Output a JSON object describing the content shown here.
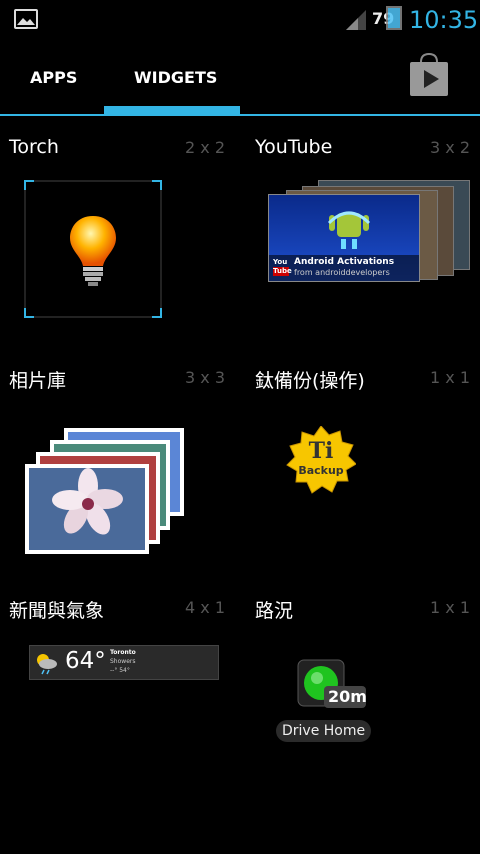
{
  "status_bar": {
    "battery_level": "79",
    "time": "10:35",
    "icons": [
      "image-icon",
      "signal-icon",
      "battery-icon"
    ]
  },
  "tabs": [
    {
      "label": "APPS",
      "selected": false
    },
    {
      "label": "WIDGETS",
      "selected": true
    }
  ],
  "store_icon": "play-store-icon",
  "accent_color": "#33b5e5",
  "widgets": [
    {
      "title": "Torch",
      "size": "2 x 2",
      "icon": "lightbulb-icon"
    },
    {
      "title": "YouTube",
      "size": "3 x 2",
      "icon": "youtube-widget-preview",
      "preview_title": "Android Activations",
      "preview_subtitle": "from androiddevelopers",
      "preview_logo_top": "You",
      "preview_logo_bottom": "Tube"
    },
    {
      "title": "相片庫",
      "size": "3 x 3",
      "icon": "photo-stack-icon"
    },
    {
      "title": "鈦備份(操作)",
      "size": "1 x 1",
      "icon": "titanium-backup-icon",
      "badge_top": "Ti",
      "badge_bottom": "Backup"
    },
    {
      "title": "新聞與氣象",
      "size": "4 x 1",
      "icon": "weather-widget-preview",
      "temperature": "64°",
      "city": "Toronto",
      "condition": "Showers",
      "range": "--°  54°"
    },
    {
      "title": "路況",
      "size": "1 x 1",
      "icon": "traffic-light-icon",
      "eta": "20m",
      "label": "Drive Home"
    }
  ]
}
